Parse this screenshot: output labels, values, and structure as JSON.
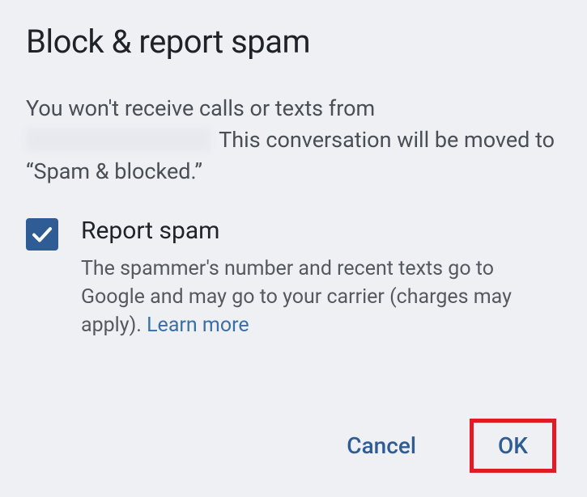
{
  "dialog": {
    "title": "Block & report spam",
    "description_prefix": "You won't receive calls or texts from ",
    "description_suffix": " This conversation will be moved to “Spam & blocked.”",
    "checkbox": {
      "checked": true,
      "label": "Report spam",
      "description": "The spammer's number and recent texts go to Google and may go to your carrier (charges may apply). ",
      "learn_more": "Learn more"
    },
    "actions": {
      "cancel": "Cancel",
      "ok": "OK"
    }
  },
  "colors": {
    "accent": "#2f5c94",
    "highlight_border": "#e01b24"
  }
}
